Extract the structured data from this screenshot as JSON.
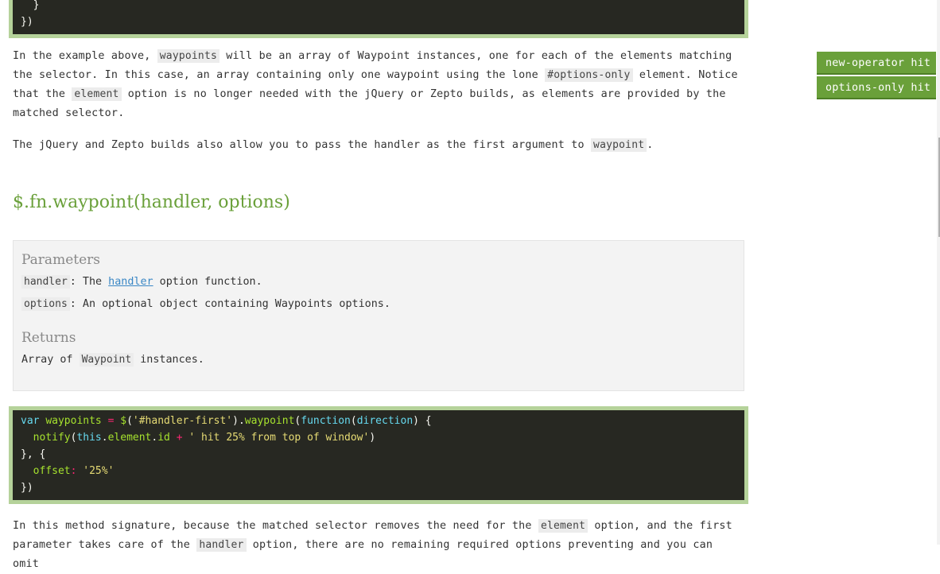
{
  "code_top": {
    "line1": "  }",
    "line2": "})"
  },
  "prose1": {
    "a1": "In the example above, ",
    "a2": "waypoints",
    "a3": " will be an array of Waypoint instances, one for each of the elements matching the selector. In this case, an array containing only one waypoint using the lone ",
    "a4": "#options-only",
    "a5": " element. Notice that the ",
    "a6": "element",
    "a7": " option is no longer needed with the jQuery or Zepto builds, as elements are provided by the matched selector.",
    "b1": "The jQuery and Zepto builds also allow you to pass the handler as the first argument to ",
    "b2": "waypoint",
    "b3": "."
  },
  "method_title": "$.fn.waypoint(handler, options)",
  "params": {
    "heading": "Parameters",
    "handler_name": "handler",
    "handler_text1": ": The ",
    "handler_link": "handler",
    "handler_text2": " option function.",
    "options_name": "options",
    "options_text": ": An optional object containing Waypoints options.",
    "returns_heading": "Returns",
    "returns_text1": "Array of ",
    "returns_code": "Waypoint",
    "returns_text2": " instances."
  },
  "code2": {
    "var": "var",
    "name": "waypoints",
    "eq": "=",
    "dollar": "$",
    "lp": "(",
    "selector": "'#handler-first'",
    "rp": ")",
    "dot": ".",
    "method": "waypoint",
    "function": "function",
    "arg": "direction",
    "brace": ") {",
    "notify": "notify",
    "this": "this",
    "element": "element",
    "id": "id",
    "plus": "+",
    "msg": "' hit 25% from top of window'",
    "close1": "}, {",
    "offset": "offset",
    "colon": ":",
    "offset_val": "'25%'",
    "close2": "})"
  },
  "prose2": {
    "c1": "In this method signature, because the matched selector removes the need for the ",
    "c2": "element",
    "c3": " option, and the first parameter takes care of the ",
    "c4": "handler",
    "c5": " option, there are no remaining required options preventing and you can omit"
  },
  "sidebar": {
    "items": [
      {
        "label": "new-operator hit"
      },
      {
        "label": "options-only hit"
      }
    ]
  },
  "colors": {
    "accent": "#6aa03a",
    "code_bg": "#272822",
    "code_border": "#b5d29a"
  }
}
